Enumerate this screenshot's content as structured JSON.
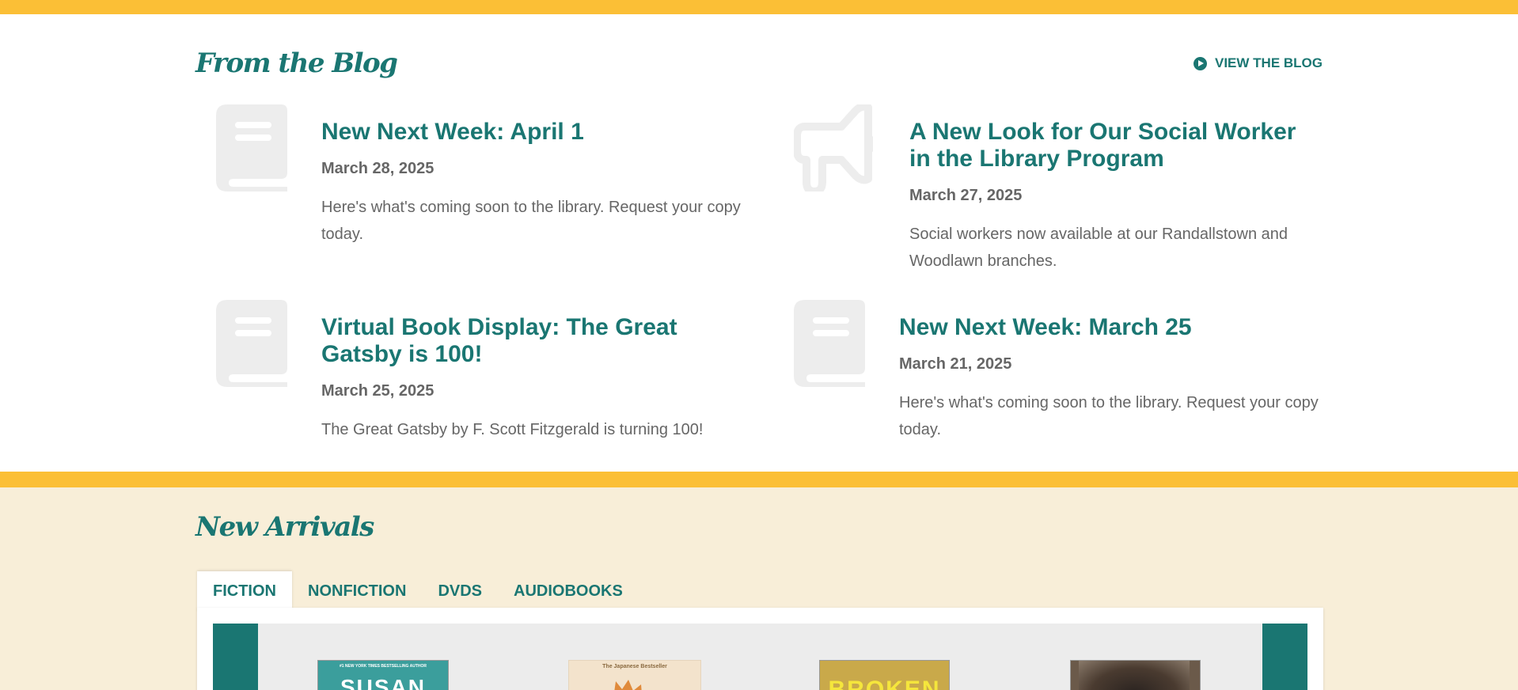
{
  "blog": {
    "title": "From the Blog",
    "view_link": "VIEW THE BLOG",
    "posts": [
      {
        "icon": "book-icon",
        "title": "New Next Week: April 1",
        "date": "March 28, 2025",
        "description": "Here's what's coming soon to the library. Request your copy today."
      },
      {
        "icon": "megaphone-icon",
        "title": "A New Look for Our Social Worker in the Library Program",
        "date": "March 27, 2025",
        "description": "Social workers now available at our Randallstown and Woodlawn branches."
      },
      {
        "icon": "book-icon",
        "title": "Virtual Book Display: The Great Gatsby is 100!",
        "date": "March 25, 2025",
        "description": "The Great Gatsby by F. Scott Fitzgerald is turning 100!"
      },
      {
        "icon": "book-icon",
        "title": "New Next Week: March 25",
        "date": "March 21, 2025",
        "description": "Here's what's coming soon to the library. Request your copy today."
      }
    ]
  },
  "arrivals": {
    "title": "New Arrivals",
    "tabs": [
      {
        "label": "FICTION",
        "active": true
      },
      {
        "label": "NONFICTION",
        "active": false
      },
      {
        "label": "DVDS",
        "active": false
      },
      {
        "label": "AUDIOBOOKS",
        "active": false
      }
    ],
    "covers": [
      {
        "caption_top": "#1 NEW YORK TIMES BESTSELLING AUTHOR",
        "text": "SUSAN",
        "bg": "#3b9e9c",
        "fg": "#ffffff"
      },
      {
        "caption_top": "The Japanese Bestseller",
        "text": "",
        "bg": "#f3e3cc",
        "fg": "#b36b2a"
      },
      {
        "caption_top": "",
        "text": "BROKEN",
        "bg": "#c9a94a",
        "fg": "#f5e63c"
      },
      {
        "caption_top": "",
        "text": "",
        "bg": "#6b5a4a",
        "fg": "#ffffff"
      }
    ]
  },
  "colors": {
    "accent": "#1a7672",
    "brand_yellow": "#fbbf36",
    "cream": "#f8eed8",
    "icon_gray": "#ededed"
  }
}
